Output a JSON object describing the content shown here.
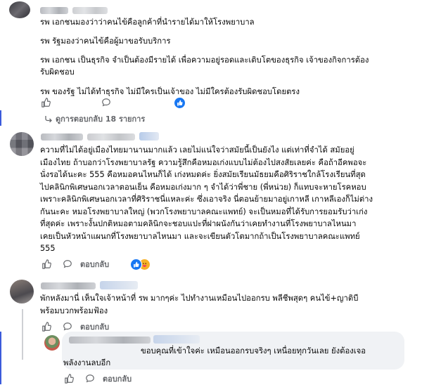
{
  "comments": [
    {
      "lines": [
        "รพ เอกชนมองว่าว่าคนไข้คือลูกค้าที่นำรายได้มาให้โรงพยาบาล",
        "",
        "รพ รัฐมองว่าคนไข้คือผู้มาขอรับบริการ",
        "",
        "รพ เอกชน เป็นธุรกิจ จำเป็นต้องมีรายได้ เพื่อความอยู่รอดและเติบโตของธุรกิจ เจ้าของกิจการต้อง",
        "รับผิดชอบ",
        "",
        "รพ ของรัฐ ไม่ได้ทำธุรกิจ ไม่มีใครเป็นเจ้าของ ไม่มีใครต้องรับผิดชอบโดยตรง"
      ],
      "view_replies": "ดูการตอบกลับ 18 รายการ"
    },
    {
      "lines": [
        "ความที่ไม่ได้อยู่เมืองไทยมานานมากแล้ว เลยไม่แน่ใจว่าสมัยนี้เป็นยังไง แต่เท่าที่จำได้ สมัยอยู่",
        "เมืองไทย ถ้าบอกว่าโรงพยาบาลรัฐ ความรู้สึกคือหมอเก่งแบบไม่ต้องไปสงสัยเลยค่ะ คือถ้าอีคพอจะ",
        "นั่งรอได้นะคะ 555 คือหมอคนไหนก็ได้ เก่งหมดค่ะ ยิ่งสมัยเรียนมัธยมคือศิริราชใกล้โรงเรียนที่สุด",
        "ไปคลินิกพิเศษนอกเวลาตอนเย็น คือหมอเก่งมาก ๆ จำได้ว่าพี่ชาย (พี่หน่วย) ก็แทบจะหายโรคหอบ",
        "เพราะคลินิกพิเศษนอกเวลาที่ศิริราชนี่แหละค่ะ ซึ่งเอาจริง นี่ตอนย้ายมาอยู่เกาหลี เกาหลีเองก็ไม่ต่าง",
        "กันนะคะ หมอโรงพยาบาลใหญ่ (พวกโรงพยาบาลคณะแพทย์) จะเป็นหมอที่ได้รับการยอมรับว่าเก่ง",
        "ที่สุดค่ะ เพราะงั้นปกติหมอตามคลินิกจะชอบแปะที่ฝาผนังกันว่าเคยทำงานที่โรงพยาบาลไหนมา",
        "เคยเป็นหัวหน้าแผนกที่โรงพยาบาลไหนมา และจะเขียนตัวโตมากถ้าเป็นโรงพยาบาลคณะแพทย์",
        "555"
      ],
      "reply_label": "ตอบกลับ"
    },
    {
      "lines": [
        "พักหลังมานี่ เห็นใจเจ้าหน้าที่ รพ มากๆค่ะ ไปทำงานเหมือนไปออกรบ พลีชีพสุดๆ คนไข้+ญาติบี",
        "พร้อมบวกพร้อมฟ้อง"
      ],
      "reply_label": "ตอบกลับ"
    },
    {
      "lines": [
        "ขอบคุณที่เข้าใจค่ะ เหมือนออกรบจริงๆ เหนื่อยทุกวันเลย ยังต้องเจอ",
        "พลังงานลบอีก"
      ],
      "reply_label": "ตอบกลับ"
    }
  ],
  "icons": [
    "thumbs-up-icon",
    "reply-bubble-icon",
    "like-reaction-icon",
    "haha-reaction-icon",
    "curved-arrow-icon"
  ],
  "colors": {
    "like": "#1877f2",
    "haha": "#f7b125",
    "love": "#f33e58",
    "thread": "#3b5bdb",
    "muted": "#65676b",
    "bubble": "#f0f2f5"
  }
}
